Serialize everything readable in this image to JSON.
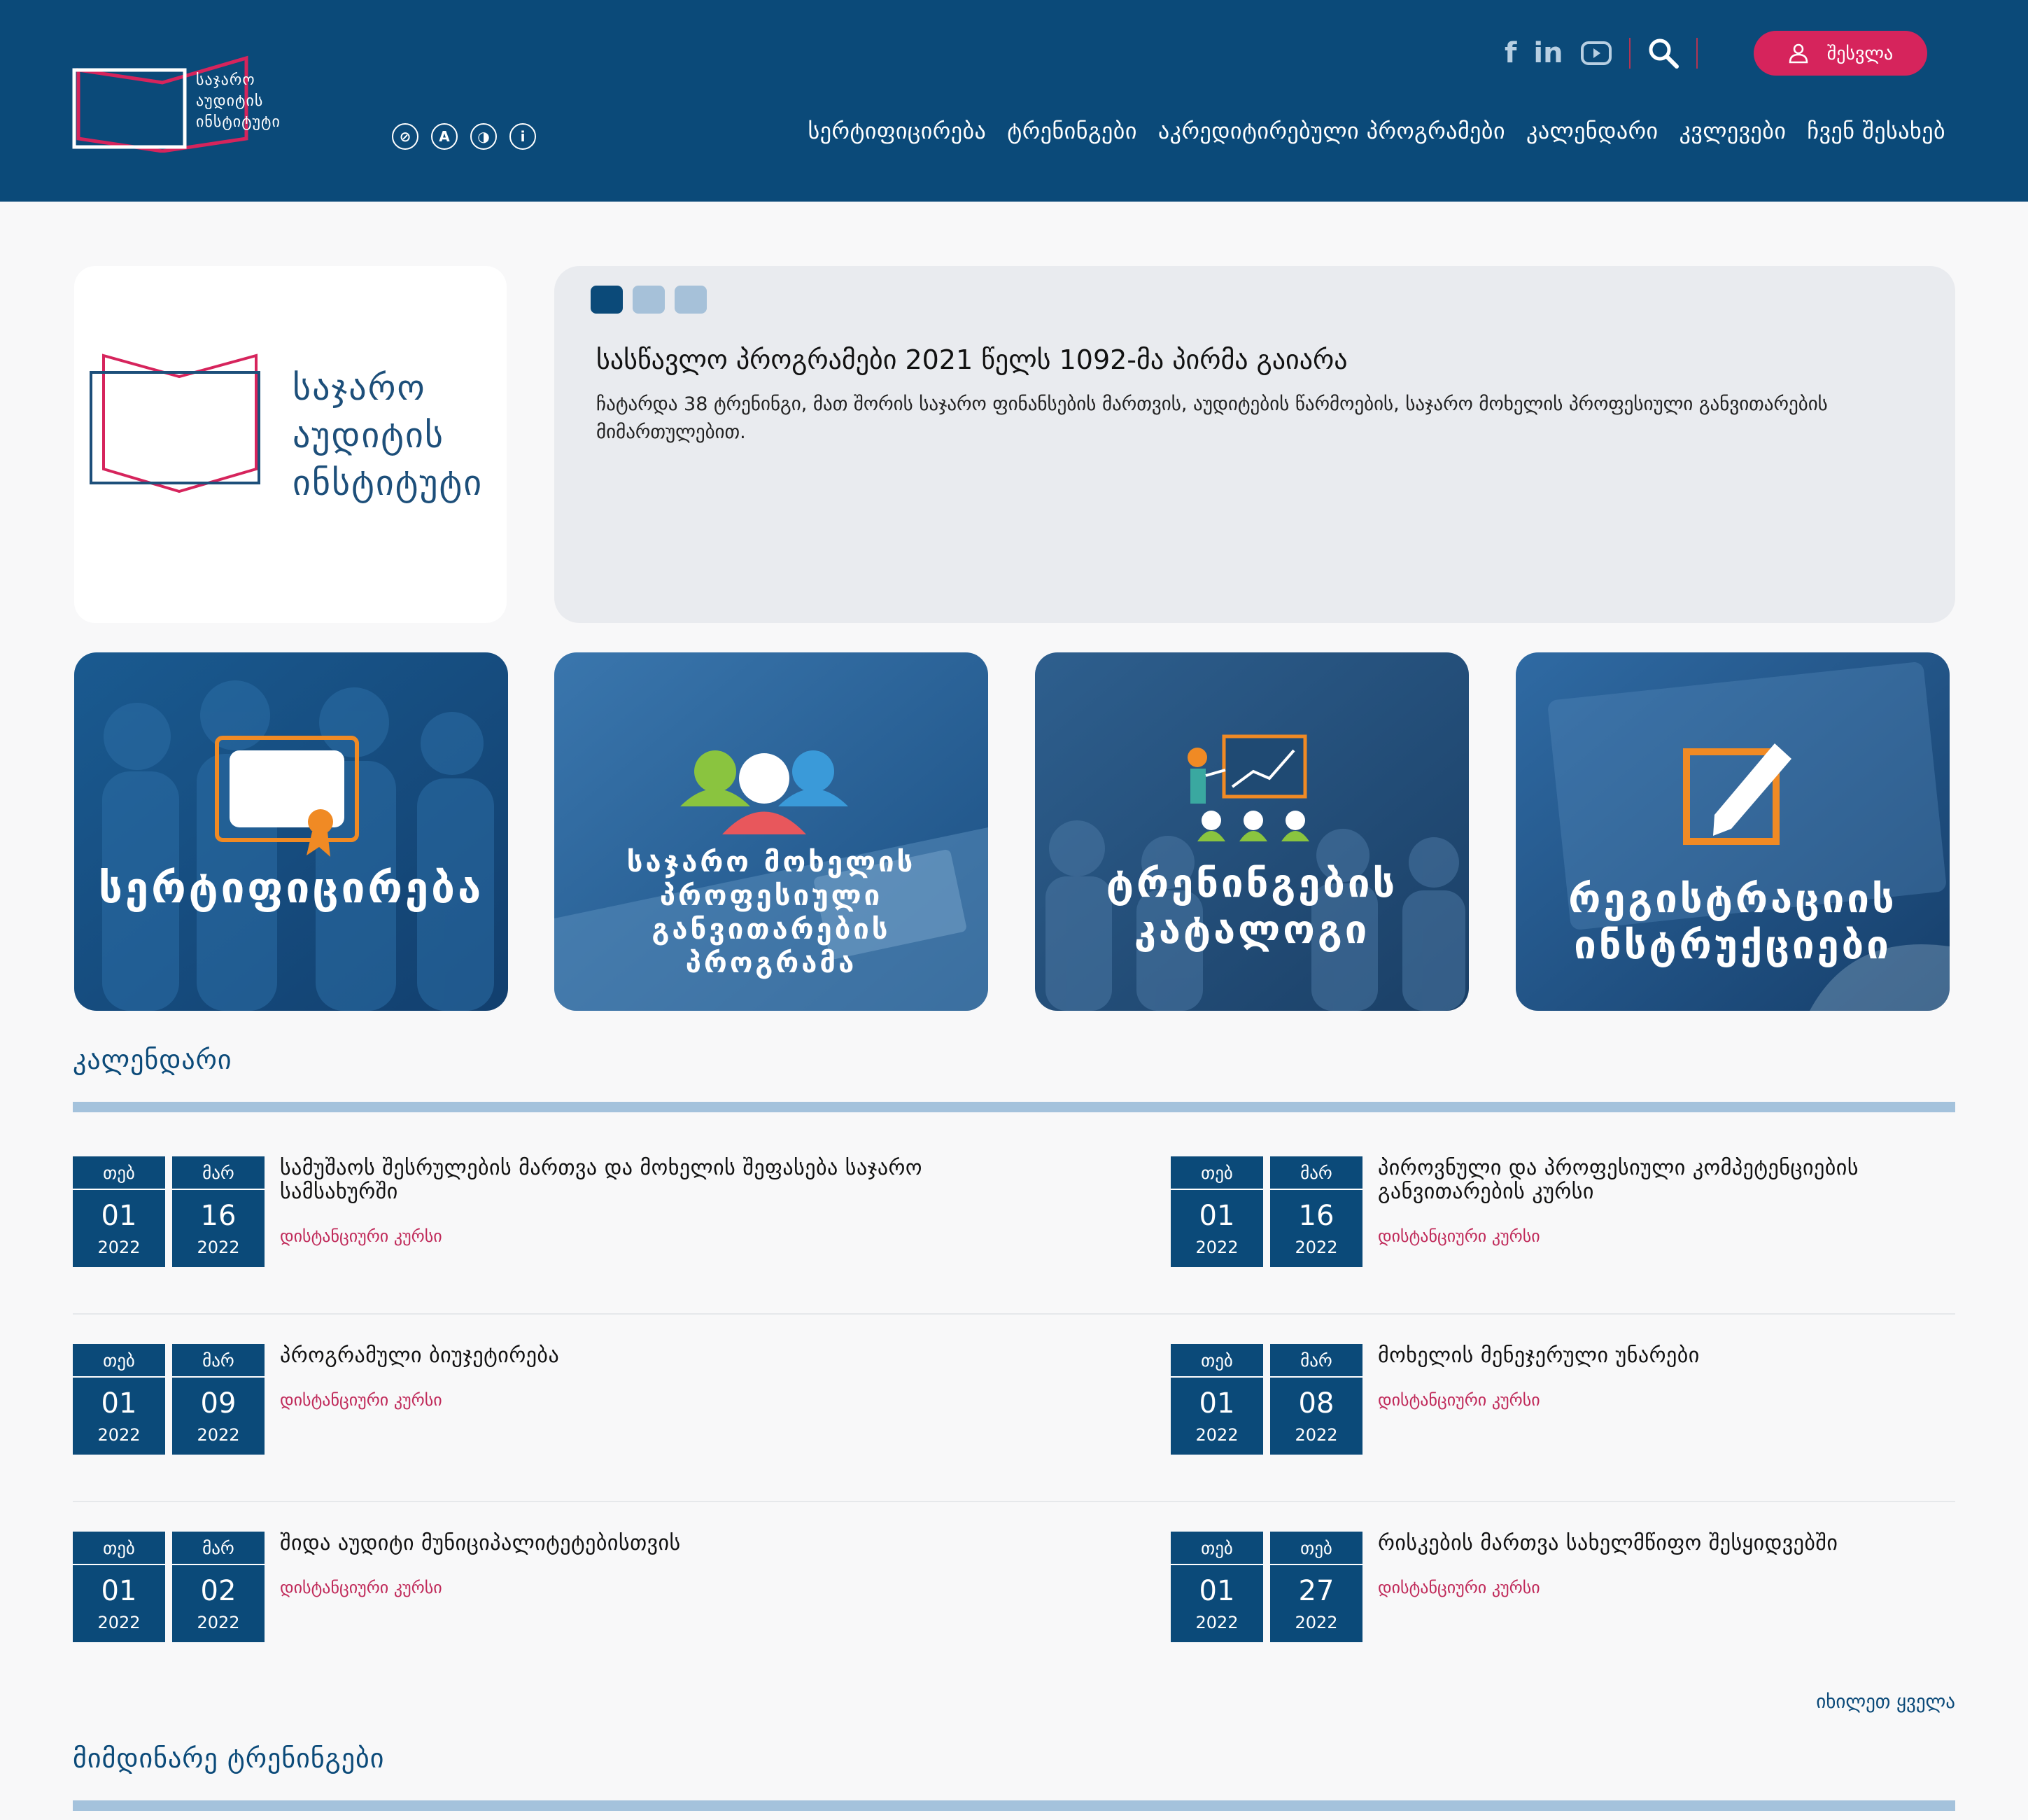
{
  "header": {
    "logo_lines": [
      "საჯარო",
      "აუდიტის",
      "ინსტიტუტი"
    ],
    "social": [
      "facebook-icon",
      "linkedin-icon",
      "youtube-icon"
    ],
    "login_label": "შესვლა",
    "nav": [
      "სერტიფიცირება",
      "ტრენინგები",
      "აკრედიტირებული პროგრამები",
      "კალენდარი",
      "კვლევები",
      "ჩვენ შესახებ"
    ]
  },
  "hero": {
    "logo_lines": [
      "საჯარო",
      "აუდიტის",
      "ინსტიტუტი"
    ],
    "slide_title": "სასწავლო პროგრამები 2021 წელს 1092-მა პირმა გაიარა",
    "slide_desc": "ჩატარდა 38 ტრენინგი, მათ შორის საჯარო ფინანსების მართვის, აუდიტების წარმოების, საჯარო მოხელის პროფესიული განვითარების მიმართულებით.",
    "slide_count": 3,
    "active_slide": 1
  },
  "tiles": [
    {
      "lines": [
        "სერტიფიცირება"
      ]
    },
    {
      "lines": [
        "საჯარო მოხელის",
        "პროფესიული",
        "განვითარების",
        "პროგრამა"
      ]
    },
    {
      "lines": [
        "ტრენინგების",
        "კატალოგი"
      ]
    },
    {
      "lines": [
        "რეგისტრაციის",
        "ინსტრუქციები"
      ]
    }
  ],
  "calendar": {
    "title": "კალენდარი",
    "see_all": "იხილეთ ყველა",
    "events": [
      {
        "title": "სამუშაოს შესრულების მართვა და მოხელის შეფასება საჯარო სამსახურში",
        "type": "დისტანციური კურსი",
        "start": {
          "month": "თებ",
          "day": "01",
          "year": "2022"
        },
        "end": {
          "month": "მარ",
          "day": "16",
          "year": "2022"
        }
      },
      {
        "title": "პიროვნული და პროფესიული კომპეტენციების განვითარების კურსი",
        "type": "დისტანციური კურსი",
        "start": {
          "month": "თებ",
          "day": "01",
          "year": "2022"
        },
        "end": {
          "month": "მარ",
          "day": "16",
          "year": "2022"
        }
      },
      {
        "title": "პროგრამული ბიუჯეტირება",
        "type": "დისტანციური კურსი",
        "start": {
          "month": "თებ",
          "day": "01",
          "year": "2022"
        },
        "end": {
          "month": "მარ",
          "day": "09",
          "year": "2022"
        }
      },
      {
        "title": "მოხელის მენეჯერული უნარები",
        "type": "დისტანციური კურსი",
        "start": {
          "month": "თებ",
          "day": "01",
          "year": "2022"
        },
        "end": {
          "month": "მარ",
          "day": "08",
          "year": "2022"
        }
      },
      {
        "title": "შიდა აუდიტი მუნიციპალიტეტებისთვის",
        "type": "დისტანციური კურსი",
        "start": {
          "month": "თებ",
          "day": "01",
          "year": "2022"
        },
        "end": {
          "month": "მარ",
          "day": "02",
          "year": "2022"
        }
      },
      {
        "title": "რისკების მართვა სახელმწიფო შესყიდვებში",
        "type": "დისტანციური კურსი",
        "start": {
          "month": "თებ",
          "day": "01",
          "year": "2022"
        },
        "end": {
          "month": "თებ",
          "day": "27",
          "year": "2022"
        }
      }
    ]
  },
  "current_trainings": {
    "title": "მიმდინარე ტრენინგები"
  },
  "colors": {
    "brand": "#0b4a79",
    "accent": "#d6245c",
    "bar": "#a4c2dc"
  }
}
